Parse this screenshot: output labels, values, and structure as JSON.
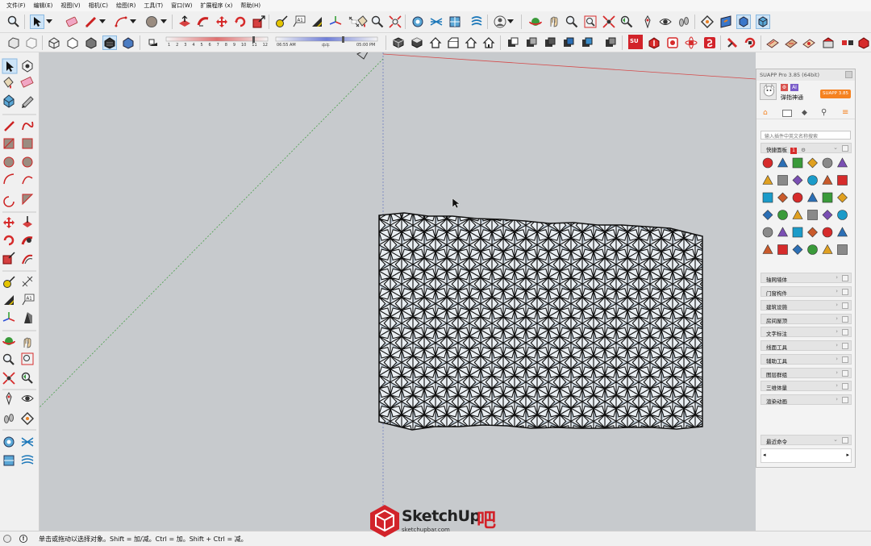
{
  "menu": [
    "文件(F)",
    "编辑(E)",
    "视图(V)",
    "相机(C)",
    "绘图(R)",
    "工具(T)",
    "窗口(W)",
    "扩展程序 (x)",
    "帮助(H)"
  ],
  "shadow": {
    "months": [
      "1",
      "2",
      "3",
      "4",
      "5",
      "6",
      "7",
      "8",
      "9",
      "10",
      "11",
      "12"
    ],
    "time_start": "06:55 AM",
    "time_mid": "中午",
    "time_end": "05:00 PM"
  },
  "suapp": {
    "title": "SUAPP Pro 3.85 (64bit)",
    "username": "弹指神通",
    "version_badge": "SUAPP 3.85",
    "search_placeholder": "输入插件中英文名称搜索",
    "quick_panel": "快捷面板",
    "quick_badge": "1",
    "categories": [
      "轴网墙体",
      "门窗构件",
      "建筑设施",
      "房间屋顶",
      "文字标注",
      "线面工具",
      "辅助工具",
      "图层群组",
      "三维体量",
      "渲染动画"
    ],
    "recent": "最近命令"
  },
  "status": {
    "message": "单击或拖动以选择对象。Shift = 加/减。Ctrl = 加。Shift + Ctrl = 减。"
  },
  "watermark": {
    "brand": "SketchUp",
    "accent": "吧",
    "site": "sketchupbar.com"
  },
  "colors": {
    "viewport_bg": "#c7cacd",
    "axis_red": "#d54a4a",
    "axis_green": "#4a9e4a",
    "accent_orange": "#f58220",
    "brand_red": "#d2232a"
  }
}
